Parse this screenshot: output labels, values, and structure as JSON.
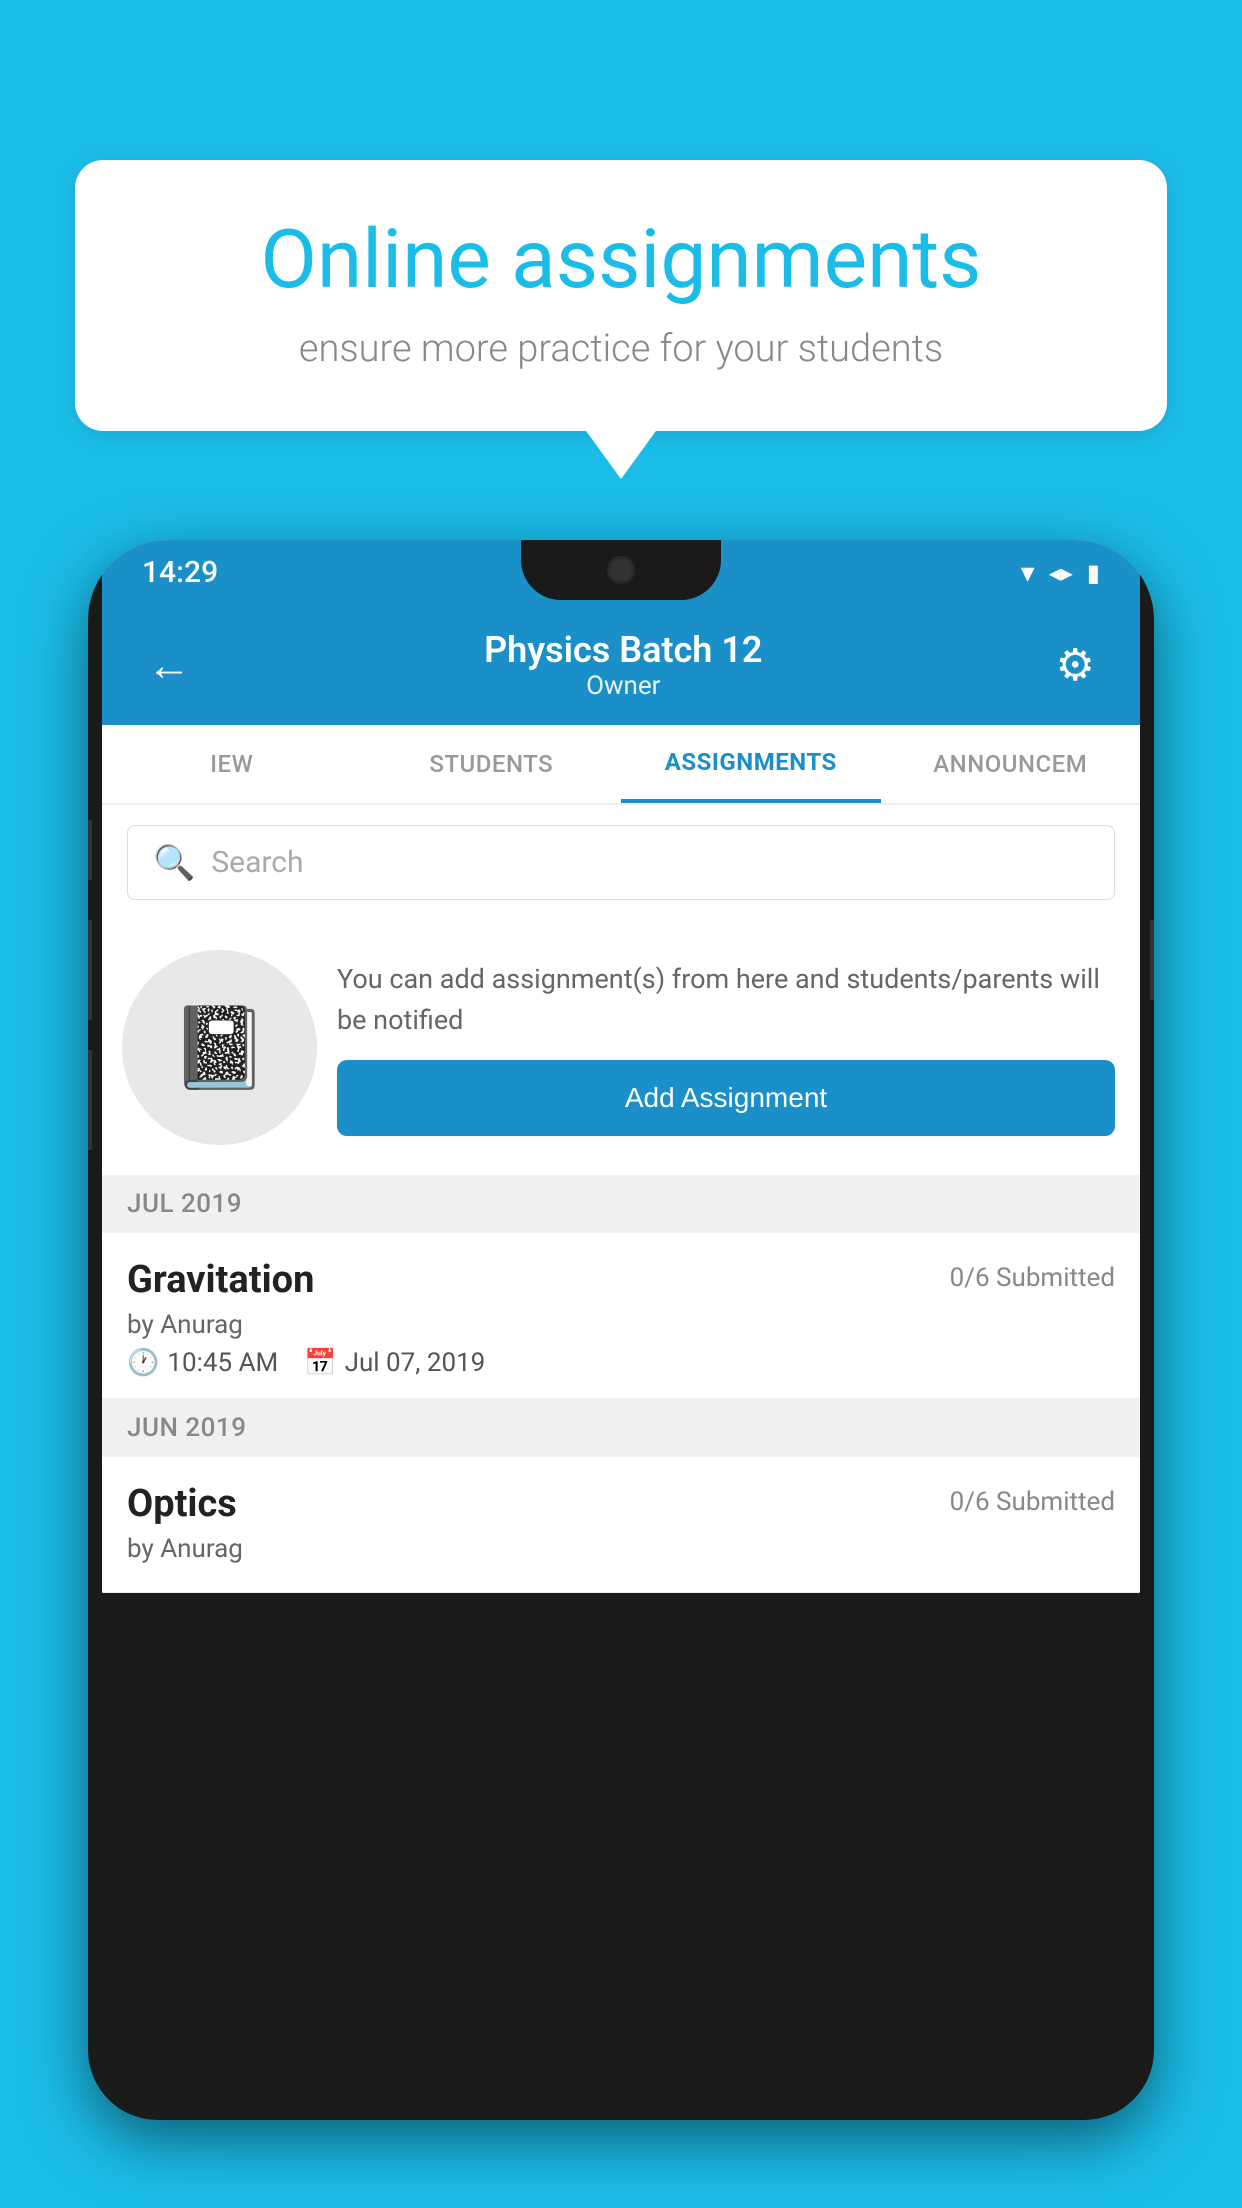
{
  "background_color": "#1BBDE8",
  "speech_bubble": {
    "title": "Online assignments",
    "subtitle": "ensure more practice for your students"
  },
  "status_bar": {
    "time": "14:29",
    "wifi": "▾",
    "signal": "▲",
    "battery": "▮"
  },
  "app_bar": {
    "title": "Physics Batch 12",
    "subtitle": "Owner",
    "back_label": "←",
    "settings_label": "⚙"
  },
  "tabs": [
    {
      "label": "IEW",
      "active": false
    },
    {
      "label": "STUDENTS",
      "active": false
    },
    {
      "label": "ASSIGNMENTS",
      "active": true
    },
    {
      "label": "ANNOUNCEM",
      "active": false
    }
  ],
  "search": {
    "placeholder": "Search"
  },
  "promo": {
    "description": "You can add assignment(s) from here and students/parents will be notified",
    "add_button_label": "Add Assignment"
  },
  "sections": [
    {
      "header": "JUL 2019",
      "assignments": [
        {
          "name": "Gravitation",
          "submitted": "0/6 Submitted",
          "author": "by Anurag",
          "time": "10:45 AM",
          "date": "Jul 07, 2019"
        }
      ]
    },
    {
      "header": "JUN 2019",
      "assignments": [
        {
          "name": "Optics",
          "submitted": "0/6 Submitted",
          "author": "by Anurag",
          "time": "",
          "date": ""
        }
      ]
    }
  ]
}
